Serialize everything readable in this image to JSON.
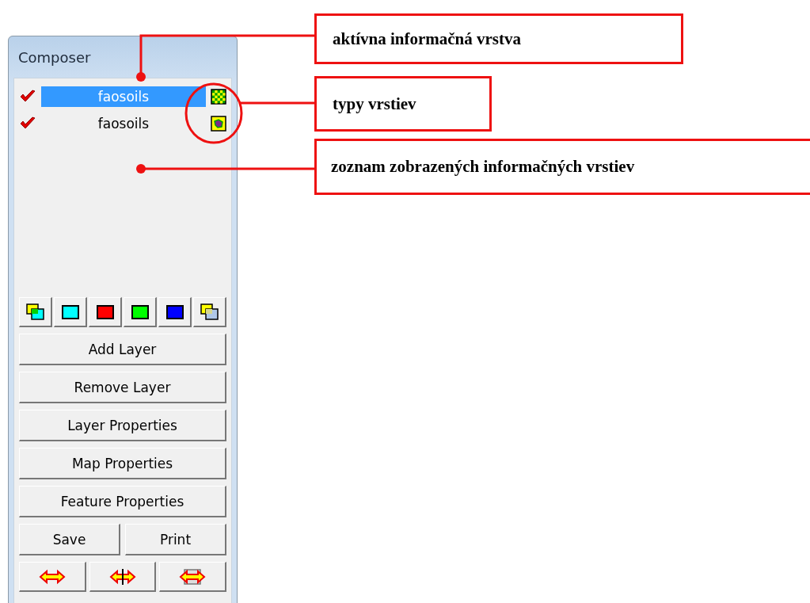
{
  "panel": {
    "title": "Composer",
    "layers": [
      {
        "name": "faosoils",
        "checked": true,
        "selected": true,
        "kind": "raster"
      },
      {
        "name": "faosoils",
        "checked": true,
        "selected": false,
        "kind": "polygon"
      }
    ],
    "buttons": [
      "Add Layer",
      "Remove Layer",
      "Layer Properties",
      "Map Properties",
      "Feature Properties"
    ],
    "pair_buttons": [
      "Save",
      "Print"
    ]
  },
  "annotations": [
    {
      "text": "aktívna informačná vrstva"
    },
    {
      "text": "typy vrstiev"
    },
    {
      "text": "zoznam zobrazených informačných vrstiev"
    }
  ]
}
